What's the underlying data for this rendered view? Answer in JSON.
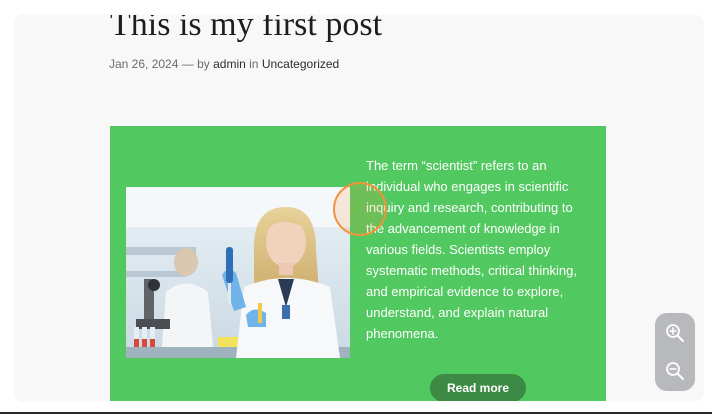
{
  "post": {
    "title": "This is my first post",
    "date": "Jan 26, 2024",
    "separator": "— by",
    "author": "admin",
    "in_word": "in",
    "category": "Uncategorized"
  },
  "card": {
    "image_icon": "scientist-photo",
    "text": "The term “scientist” refers to an individual who engages in scientific inquiry and research, contributing to the advancement of knowledge in various fields. Scientists employ systematic methods, critical thinking, and empirical evidence to explore, understand, and explain natural phenomena.",
    "read_more_label": "Read more",
    "background_color": "#52c860",
    "button_color": "#3c8a44"
  },
  "zoom": {
    "zoom_in_icon": "zoom-in-icon",
    "zoom_out_icon": "zoom-out-icon"
  }
}
